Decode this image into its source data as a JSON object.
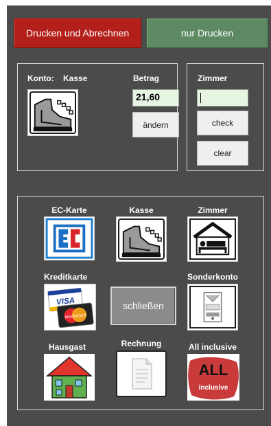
{
  "top_buttons": {
    "print_and_bill": "Drucken und Abrechnen",
    "print_only": "nur Drucken"
  },
  "account": {
    "label": "Konto:",
    "value": "Kasse",
    "amount_label": "Betrag",
    "amount_value": "21,60",
    "change_button": "ändern"
  },
  "room": {
    "label": "Zimmer",
    "input_value": "",
    "check_button": "check",
    "clear_button": "clear"
  },
  "payment_methods": {
    "ec": "EC-Karte",
    "cash": "Kasse",
    "room": "Zimmer",
    "credit": "Kreditkarte",
    "close": "schließen",
    "special": "Sonderkonto",
    "house_guest": "Hausgast",
    "invoice": "Rechnung",
    "all_inclusive": "All inclusive"
  },
  "icon_text": {
    "visa": "VISA",
    "mastercard": "MasterCard",
    "all": "ALL",
    "inclusive": "inclusive"
  },
  "colors": {
    "window_bg": "#4b4b4b",
    "print_bill": "#b3201b",
    "print_only": "#5e8a63",
    "input_bg": "#e6f6e2"
  }
}
